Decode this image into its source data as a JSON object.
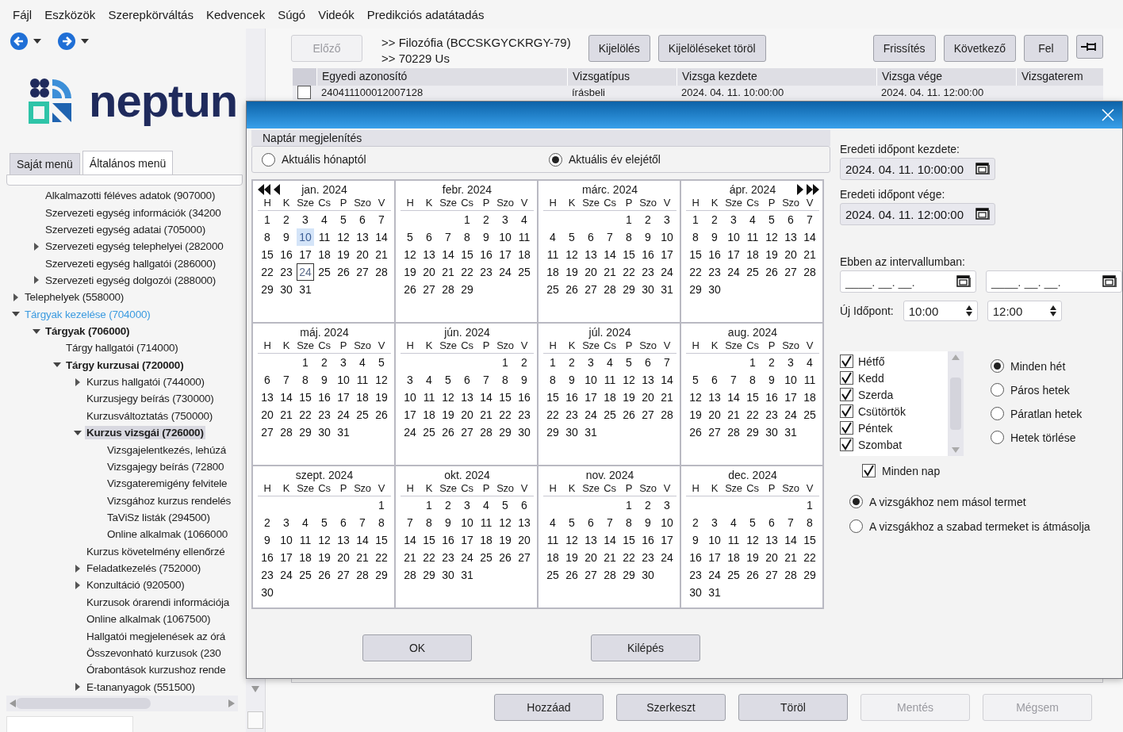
{
  "menu": [
    "Fájl",
    "Eszközök",
    "Szerepkörváltás",
    "Kedvencek",
    "Súgó",
    "Videók",
    "Predikciós adatátadás"
  ],
  "logo": {
    "text": "neptun"
  },
  "menu_tabs": [
    {
      "label": "Saját menü",
      "selected": false
    },
    {
      "label": "Általános menü",
      "selected": true
    }
  ],
  "tree": [
    {
      "children": [
        {
          "label": "Alkalmazotti féléves adatok (907000)",
          "selected": false
        },
        {
          "label": "Szervezeti egység információk (34200",
          "selected": false
        },
        {
          "label": "Szervezeti egység adatai (705000)",
          "selected": false
        },
        {
          "label": "Szervezeti egység telephelyei (282000",
          "selected": false,
          "expanded": false
        },
        {
          "label": "Szervezeti egység hallgatói (286000)",
          "selected": false
        },
        {
          "label": "Szervezeti egység dolgozói (288000)",
          "selected": false,
          "expanded": false
        }
      ]
    },
    {
      "label": "Telephelyek (558000)",
      "selected": false,
      "expanded": false
    },
    {
      "label": "Tárgyak kezelése (704000)",
      "selected": false,
      "expanded": true,
      "highlighted": true,
      "children": [
        {
          "label": "Tárgyak (706000)",
          "selected": false,
          "expanded": true,
          "bold": true,
          "children": [
            {
              "label": "Tárgy hallgatói (714000)",
              "selected": false
            },
            {
              "label": "Tárgy kurzusai (720000)",
              "selected": false,
              "expanded": true,
              "bold": true,
              "children": [
                {
                  "label": "Kurzus hallgatói (744000)",
                  "selected": false,
                  "expanded": false
                },
                {
                  "label": "Kurzusjegy beírás (730000)",
                  "selected": false
                },
                {
                  "label": "Kurzusváltoztatás (750000)",
                  "selected": false
                },
                {
                  "label": "Kurzus vizsgái (726000)",
                  "selected": true,
                  "expanded": true,
                  "bold": true,
                  "children": [
                    {
                      "label": "Vizsgajelentkezés, lehúzá",
                      "selected": false
                    },
                    {
                      "label": "Vizsgajegy beírás (72800",
                      "selected": false
                    },
                    {
                      "label": "Vizsgateremigény felvitele",
                      "selected": false
                    },
                    {
                      "label": "Vizsgához kurzus rendelés",
                      "selected": false
                    },
                    {
                      "label": "TaViSz listák (294500)",
                      "selected": false
                    },
                    {
                      "label": "Online alkalmak (1066000",
                      "selected": false
                    }
                  ]
                },
                {
                  "label": "Kurzus követelmény ellenőrzé",
                  "selected": false
                },
                {
                  "label": "Feladatkezelés (752000)",
                  "selected": false,
                  "expanded": false
                },
                {
                  "label": "Konzultáció (920500)",
                  "selected": false,
                  "expanded": false
                },
                {
                  "label": "Kurzusok órarendi információja",
                  "selected": false
                },
                {
                  "label": "Online alkalmak (1067500)",
                  "selected": false
                },
                {
                  "label": "Hallgatói megjelenések az órá",
                  "selected": false
                },
                {
                  "label": "Összevonható kurzusok (230",
                  "selected": false
                },
                {
                  "label": "Órabontások kurzushoz rende",
                  "selected": false
                },
                {
                  "label": "E-tananyagok (551500)",
                  "selected": false,
                  "expanded": false
                }
              ]
            }
          ]
        }
      ]
    }
  ],
  "toolbar": {
    "prev_button": {
      "label": "Előző",
      "disabled": true
    },
    "breadcrumbs": [
      ">> Filozófia (BCCSKGYCKRGY-79)",
      ">> 70229 Us"
    ],
    "left_buttons": [
      "Kijelölés",
      "Kijelöléseket töröl"
    ],
    "right_buttons": [
      "Frissítés",
      "Következő",
      "Fel"
    ]
  },
  "table": {
    "columns": [
      "Egyedi azonosító",
      "Vizsgatípus",
      "Vizsga kezdete",
      "Vizsga vége",
      "Vizsgaterem"
    ],
    "rows": [
      {
        "checked": false,
        "cells": [
          "240411100012007128",
          "írásbeli",
          "2024. 04. 11. 10:00:00",
          "2024. 04. 11. 12:00:00"
        ]
      }
    ]
  },
  "bottom_buttons": [
    {
      "label": "Hozzáad",
      "disabled": false
    },
    {
      "label": "Szerkeszt",
      "disabled": false
    },
    {
      "label": "Töröl",
      "disabled": false
    },
    {
      "label": "Mentés",
      "disabled": true
    },
    {
      "label": "Mégsem",
      "disabled": true
    }
  ],
  "dialog": {
    "calendar_title": "Naptár megjelenítés",
    "range_options": [
      {
        "label": "Aktuális hónaptól",
        "selected": false
      },
      {
        "label": "Aktuális év elejétől",
        "selected": true
      }
    ],
    "months": [
      {
        "title": "jan. 2024",
        "kind": "first",
        "weekdays": [
          "H",
          "K",
          "Sze",
          "Cs",
          "P",
          "Szo",
          "V"
        ],
        "weeks": [
          {
            "mon": "1",
            "tue": "2",
            "wed": "3",
            "thu": "4",
            "fri": "5",
            "sat": "6",
            "sun": "7"
          },
          {
            "mon": "8",
            "tue": "9",
            "wed": {
              "day": "10",
              "highlighted": true
            },
            "thu": "11",
            "fri": "12",
            "sat": "13",
            "sun": "14"
          },
          {
            "mon": "15",
            "tue": "16",
            "wed": "17",
            "thu": "18",
            "fri": "19",
            "sat": "20",
            "sun": "21"
          },
          {
            "mon": "22",
            "tue": "23",
            "wed": {
              "day": "24",
              "today": true
            },
            "thu": "25",
            "fri": "26",
            "sat": "27",
            "sun": "28"
          },
          {
            "mon": "29",
            "tue": "30",
            "wed": "31"
          }
        ]
      },
      {
        "title": "febr. 2024",
        "kind": "plain",
        "weekdays": [
          "H",
          "K",
          "Sze",
          "Cs",
          "P",
          "Szo",
          "V"
        ],
        "weeks": [
          {
            "thu": "1",
            "fri": "2",
            "sat": "3",
            "sun": "4"
          },
          {
            "mon": "5",
            "tue": "6",
            "wed": "7",
            "thu": "8",
            "fri": "9",
            "sat": "10",
            "sun": "11"
          },
          {
            "mon": "12",
            "tue": "13",
            "wed": "14",
            "thu": "15",
            "fri": "16",
            "sat": "17",
            "sun": "18"
          },
          {
            "mon": "19",
            "tue": "20",
            "wed": "21",
            "thu": "22",
            "fri": "23",
            "sat": "24",
            "sun": "25"
          },
          {
            "mon": "26",
            "tue": "27",
            "wed": "28",
            "thu": "29"
          }
        ]
      },
      {
        "title": "márc. 2024",
        "kind": "plain",
        "weekdays": [
          "H",
          "K",
          "Sze",
          "Cs",
          "P",
          "Szo",
          "V"
        ],
        "weeks": [
          {
            "fri": "1",
            "sat": "2",
            "sun": "3"
          },
          {
            "mon": "4",
            "tue": "5",
            "wed": "6",
            "thu": "7",
            "fri": "8",
            "sat": "9",
            "sun": "10"
          },
          {
            "mon": "11",
            "tue": "12",
            "wed": "13",
            "thu": "14",
            "fri": "15",
            "sat": "16",
            "sun": "17"
          },
          {
            "mon": "18",
            "tue": "19",
            "wed": "20",
            "thu": "21",
            "fri": "22",
            "sat": "23",
            "sun": "24"
          },
          {
            "mon": "25",
            "tue": "26",
            "wed": "27",
            "thu": "28",
            "fri": "29",
            "sat": "30",
            "sun": "31"
          }
        ]
      },
      {
        "title": "ápr. 2024",
        "kind": "last",
        "weekdays": [
          "H",
          "K",
          "Sze",
          "Cs",
          "P",
          "Szo",
          "V"
        ],
        "weeks": [
          {
            "mon": "1",
            "tue": "2",
            "wed": "3",
            "thu": "4",
            "fri": "5",
            "sat": "6",
            "sun": "7"
          },
          {
            "mon": "8",
            "tue": "9",
            "wed": "10",
            "thu": "11",
            "fri": "12",
            "sat": "13",
            "sun": "14"
          },
          {
            "mon": "15",
            "tue": "16",
            "wed": "17",
            "thu": "18",
            "fri": "19",
            "sat": "20",
            "sun": "21"
          },
          {
            "mon": "22",
            "tue": "23",
            "wed": "24",
            "thu": "25",
            "fri": "26",
            "sat": "27",
            "sun": "28"
          },
          {
            "mon": "29",
            "tue": "30"
          }
        ]
      },
      {
        "title": "máj. 2024",
        "kind": "plain",
        "weekdays": [
          "H",
          "K",
          "Sze",
          "Cs",
          "P",
          "Szo",
          "V"
        ],
        "weeks": [
          {
            "wed": "1",
            "thu": "2",
            "fri": "3",
            "sat": "4",
            "sun": "5"
          },
          {
            "mon": "6",
            "tue": "7",
            "wed": "8",
            "thu": "9",
            "fri": "10",
            "sat": "11",
            "sun": "12"
          },
          {
            "mon": "13",
            "tue": "14",
            "wed": "15",
            "thu": "16",
            "fri": "17",
            "sat": "18",
            "sun": "19"
          },
          {
            "mon": "20",
            "tue": "21",
            "wed": "22",
            "thu": "23",
            "fri": "24",
            "sat": "25",
            "sun": "26"
          },
          {
            "mon": "27",
            "tue": "28",
            "wed": "29",
            "thu": "30",
            "fri": "31"
          }
        ]
      },
      {
        "title": "jún. 2024",
        "kind": "plain",
        "weekdays": [
          "H",
          "K",
          "Sze",
          "Cs",
          "P",
          "Szo",
          "V"
        ],
        "weeks": [
          {
            "sat": "1",
            "sun": "2"
          },
          {
            "mon": "3",
            "tue": "4",
            "wed": "5",
            "thu": "6",
            "fri": "7",
            "sat": "8",
            "sun": "9"
          },
          {
            "mon": "10",
            "tue": "11",
            "wed": "12",
            "thu": "13",
            "fri": "14",
            "sat": "15",
            "sun": "16"
          },
          {
            "mon": "17",
            "tue": "18",
            "wed": "19",
            "thu": "20",
            "fri": "21",
            "sat": "22",
            "sun": "23"
          },
          {
            "mon": "24",
            "tue": "25",
            "wed": "26",
            "thu": "27",
            "fri": "28",
            "sat": "29",
            "sun": "30"
          }
        ]
      },
      {
        "title": "júl. 2024",
        "kind": "plain",
        "weekdays": [
          "H",
          "K",
          "Sze",
          "Cs",
          "P",
          "Szo",
          "V"
        ],
        "weeks": [
          {
            "mon": "1",
            "tue": "2",
            "wed": "3",
            "thu": "4",
            "fri": "5",
            "sat": "6",
            "sun": "7"
          },
          {
            "mon": "8",
            "tue": "9",
            "wed": "10",
            "thu": "11",
            "fri": "12",
            "sat": "13",
            "sun": "14"
          },
          {
            "mon": "15",
            "tue": "16",
            "wed": "17",
            "thu": "18",
            "fri": "19",
            "sat": "20",
            "sun": "21"
          },
          {
            "mon": "22",
            "tue": "23",
            "wed": "24",
            "thu": "25",
            "fri": "26",
            "sat": "27",
            "sun": "28"
          },
          {
            "mon": "29",
            "tue": "30",
            "wed": "31"
          }
        ]
      },
      {
        "title": "aug. 2024",
        "kind": "plain",
        "weekdays": [
          "H",
          "K",
          "Sze",
          "Cs",
          "P",
          "Szo",
          "V"
        ],
        "weeks": [
          {
            "thu": "1",
            "fri": "2",
            "sat": "3",
            "sun": "4"
          },
          {
            "mon": "5",
            "tue": "6",
            "wed": "7",
            "thu": "8",
            "fri": "9",
            "sat": "10",
            "sun": "11"
          },
          {
            "mon": "12",
            "tue": "13",
            "wed": "14",
            "thu": "15",
            "fri": "16",
            "sat": "17",
            "sun": "18"
          },
          {
            "mon": "19",
            "tue": "20",
            "wed": "21",
            "thu": "22",
            "fri": "23",
            "sat": "24",
            "sun": "25"
          },
          {
            "mon": "26",
            "tue": "27",
            "wed": "28",
            "thu": "29",
            "fri": "30",
            "sat": "31"
          }
        ]
      },
      {
        "title": "szept. 2024",
        "kind": "plain",
        "weekdays": [
          "H",
          "K",
          "Sze",
          "Cs",
          "P",
          "Szo",
          "V"
        ],
        "weeks": [
          {
            "sun": "1"
          },
          {
            "mon": "2",
            "tue": "3",
            "wed": "4",
            "thu": "5",
            "fri": "6",
            "sat": "7",
            "sun": "8"
          },
          {
            "mon": "9",
            "tue": "10",
            "wed": "11",
            "thu": "12",
            "fri": "13",
            "sat": "14",
            "sun": "15"
          },
          {
            "mon": "16",
            "tue": "17",
            "wed": "18",
            "thu": "19",
            "fri": "20",
            "sat": "21",
            "sun": "22"
          },
          {
            "mon": "23",
            "tue": "24",
            "wed": "25",
            "thu": "26",
            "fri": "27",
            "sat": "28",
            "sun": "29"
          },
          {
            "mon": "30"
          }
        ]
      },
      {
        "title": "okt. 2024",
        "kind": "plain",
        "weekdays": [
          "H",
          "K",
          "Sze",
          "Cs",
          "P",
          "Szo",
          "V"
        ],
        "weeks": [
          {
            "tue": "1",
            "wed": "2",
            "thu": "3",
            "fri": "4",
            "sat": "5",
            "sun": "6"
          },
          {
            "mon": "7",
            "tue": "8",
            "wed": "9",
            "thu": "10",
            "fri": "11",
            "sat": "12",
            "sun": "13"
          },
          {
            "mon": "14",
            "tue": "15",
            "wed": "16",
            "thu": "17",
            "fri": "18",
            "sat": "19",
            "sun": "20"
          },
          {
            "mon": "21",
            "tue": "22",
            "wed": "23",
            "thu": "24",
            "fri": "25",
            "sat": "26",
            "sun": "27"
          },
          {
            "mon": "28",
            "tue": "29",
            "wed": "30",
            "thu": "31"
          }
        ]
      },
      {
        "title": "nov. 2024",
        "kind": "plain",
        "weekdays": [
          "H",
          "K",
          "Sze",
          "Cs",
          "P",
          "Szo",
          "V"
        ],
        "weeks": [
          {
            "fri": "1",
            "sat": "2",
            "sun": "3"
          },
          {
            "mon": "4",
            "tue": "5",
            "wed": "6",
            "thu": "7",
            "fri": "8",
            "sat": "9",
            "sun": "10"
          },
          {
            "mon": "11",
            "tue": "12",
            "wed": "13",
            "thu": "14",
            "fri": "15",
            "sat": "16",
            "sun": "17"
          },
          {
            "mon": "18",
            "tue": "19",
            "wed": "20",
            "thu": "21",
            "fri": "22",
            "sat": "23",
            "sun": "24"
          },
          {
            "mon": "25",
            "tue": "26",
            "wed": "27",
            "thu": "28",
            "fri": "29",
            "sat": "30"
          }
        ]
      },
      {
        "title": "dec. 2024",
        "kind": "plain",
        "weekdays": [
          "H",
          "K",
          "Sze",
          "Cs",
          "P",
          "Szo",
          "V"
        ],
        "weeks": [
          {
            "sun": "1"
          },
          {
            "mon": "2",
            "tue": "3",
            "wed": "4",
            "thu": "5",
            "fri": "6",
            "sat": "7",
            "sun": "8"
          },
          {
            "mon": "9",
            "tue": "10",
            "wed": "11",
            "thu": "12",
            "fri": "13",
            "sat": "14",
            "sun": "15"
          },
          {
            "mon": "16",
            "tue": "17",
            "wed": "18",
            "thu": "19",
            "fri": "20",
            "sat": "21",
            "sun": "22"
          },
          {
            "mon": "23",
            "tue": "24",
            "wed": "25",
            "thu": "26",
            "fri": "27",
            "sat": "28",
            "sun": "29"
          },
          {
            "mon": "30",
            "tue": "31"
          }
        ]
      }
    ],
    "buttons": [
      "OK",
      "Kilépés"
    ],
    "original_start": {
      "label": "Eredeti időpont kezdete:",
      "value": "2024. 04. 11. 10:00:00"
    },
    "original_end": {
      "label": "Eredeti időpont vége:",
      "value": "2024. 04. 11. 12:00:00"
    },
    "interval": {
      "label": "Ebben az intervallumban:",
      "fields": [
        {
          "placeholder": "____. __. __."
        },
        {
          "placeholder": "____. __. __."
        }
      ]
    },
    "new_time": {
      "label": "Új Időpont:",
      "from": "10:00",
      "to": "12:00"
    },
    "days": [
      {
        "label": "Hétfő",
        "checked": true
      },
      {
        "label": "Kedd",
        "checked": true
      },
      {
        "label": "Szerda",
        "checked": true
      },
      {
        "label": "Csütörtök",
        "checked": true
      },
      {
        "label": "Péntek",
        "checked": true
      },
      {
        "label": "Szombat",
        "checked": true
      }
    ],
    "all_days": {
      "label": "Minden nap",
      "checked": true
    },
    "week_options": [
      {
        "label": "Minden hét",
        "selected": true
      },
      {
        "label": "Páros hetek",
        "selected": false
      },
      {
        "label": "Páratlan hetek",
        "selected": false
      },
      {
        "label": "Hetek törlése",
        "selected": false
      }
    ],
    "room_options": [
      {
        "label": "A vizsgákhoz nem másol termet",
        "selected": true
      },
      {
        "label": "A vizsgákhoz a szabad termeket is átmásolja",
        "selected": false
      }
    ]
  }
}
